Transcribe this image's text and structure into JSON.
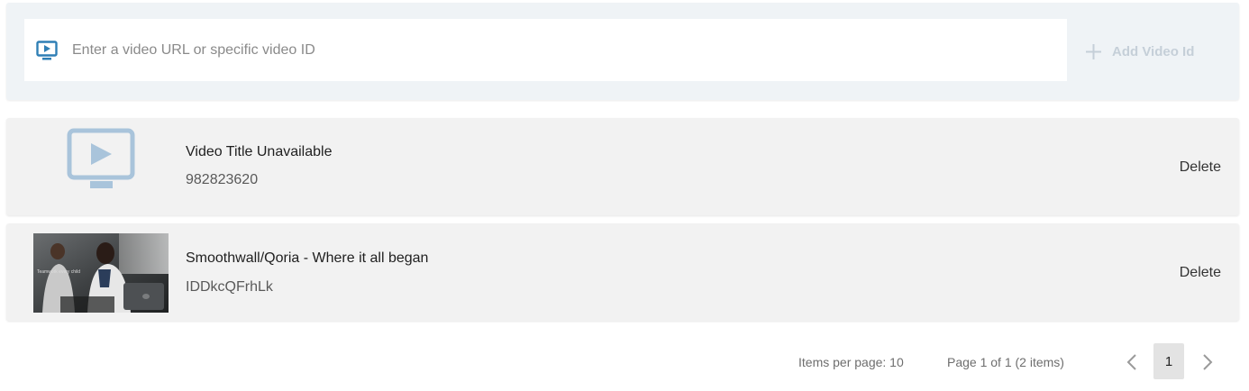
{
  "add_video": {
    "input_placeholder": "Enter a video URL or specific video ID",
    "input_value": "",
    "add_button_label": "Add Video Id",
    "icon": "video-icon"
  },
  "videos": [
    {
      "title": "Video Title Unavailable",
      "id": "982823620",
      "thumbnail": "placeholder-video-icon",
      "delete_label": "Delete"
    },
    {
      "title": "Smoothwall/Qoria - Where it all began",
      "id": "IDDkcQFrhLk",
      "thumbnail": "video-thumbnail",
      "thumbnail_caption": "Teamwork every child",
      "delete_label": "Delete"
    }
  ],
  "pagination": {
    "items_per_page": "Items per page: 10",
    "page_info": "Page 1 of 1 (2 items)",
    "current_page": "1"
  },
  "colors": {
    "accent": "#2f7fb5",
    "placeholder_icon": "#a9c4db",
    "add_button_disabled": "#c5cfd8",
    "row_background": "#f2f2f2",
    "bar_background": "#eff3f6"
  }
}
